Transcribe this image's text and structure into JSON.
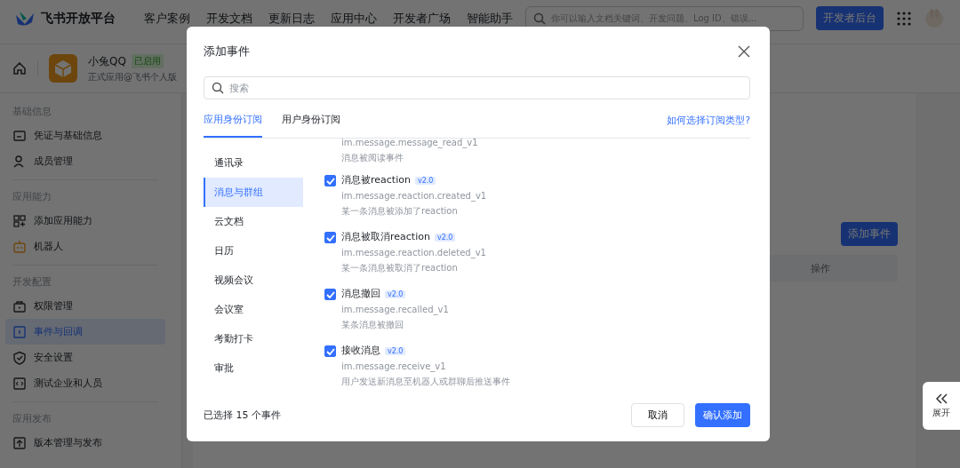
{
  "topnav": {
    "brand": "飞书开放平台",
    "links": [
      "客户案例",
      "开发文档",
      "更新日志",
      "应用中心",
      "开发者广场",
      "智能助手"
    ],
    "search_placeholder": "你可以输入文档关键词、开发问题、Log ID、错误...",
    "console_button": "开发者后台"
  },
  "app": {
    "name": "小兔QQ",
    "status": "已启用",
    "subtitle": "正式应用@飞书个人版"
  },
  "sidebar": {
    "groups": [
      {
        "title": "基础信息",
        "items": [
          {
            "label": "凭证与基础信息",
            "selected": false
          },
          {
            "label": "成员管理",
            "selected": false
          }
        ]
      },
      {
        "title": "应用能力",
        "items": [
          {
            "label": "添加应用能力",
            "selected": false
          },
          {
            "label": "机器人",
            "selected": false
          }
        ]
      },
      {
        "title": "开发配置",
        "items": [
          {
            "label": "权限管理",
            "selected": false
          },
          {
            "label": "事件与回调",
            "selected": true
          },
          {
            "label": "安全设置",
            "selected": false
          },
          {
            "label": "测试企业和人员",
            "selected": false
          }
        ]
      },
      {
        "title": "应用发布",
        "items": [
          {
            "label": "版本管理与发布",
            "selected": false
          }
        ]
      }
    ]
  },
  "main": {
    "add_button": "添加事件",
    "table": {
      "columns": [
        "操作"
      ]
    },
    "expand_button": "展开"
  },
  "dialog": {
    "title": "添加事件",
    "search": {
      "placeholder": "搜索"
    },
    "tabs": [
      {
        "label": "应用身份订阅",
        "selected": true
      },
      {
        "label": "用户身份订阅",
        "selected": false
      }
    ],
    "help_link": "如何选择订阅类型?",
    "categories": [
      {
        "label": "通讯录",
        "selected": false
      },
      {
        "label": "消息与群组",
        "selected": true
      },
      {
        "label": "云文档",
        "selected": false
      },
      {
        "label": "日历",
        "selected": false
      },
      {
        "label": "视频会议",
        "selected": false
      },
      {
        "label": "会议室",
        "selected": false
      },
      {
        "label": "考勤打卡",
        "selected": false
      },
      {
        "label": "审批",
        "selected": false
      }
    ],
    "events": [
      {
        "code": "im.message.message_read_v1",
        "description": "消息被阅读事件"
      },
      {
        "title": "消息被reaction",
        "version": "v2.0",
        "checked": true,
        "code": "im.message.reaction.created_v1",
        "description": "某一条消息被添加了reaction"
      },
      {
        "title": "消息被取消reaction",
        "version": "v2.0",
        "checked": true,
        "code": "im.message.reaction.deleted_v1",
        "description": "某一条消息被取消了reaction"
      },
      {
        "title": "消息撤回",
        "version": "v2.0",
        "checked": true,
        "code": "im.message.recalled_v1",
        "description": "某条消息被撤回"
      },
      {
        "title": "接收消息",
        "version": "v2.0",
        "checked": true,
        "code": "im.message.receive_v1",
        "description": "用户发送新消息至机器人或群聊后推送事件"
      }
    ],
    "selected_count": "已选择 15 个事件",
    "cancel_button": "取消",
    "confirm_button": "确认添加"
  }
}
